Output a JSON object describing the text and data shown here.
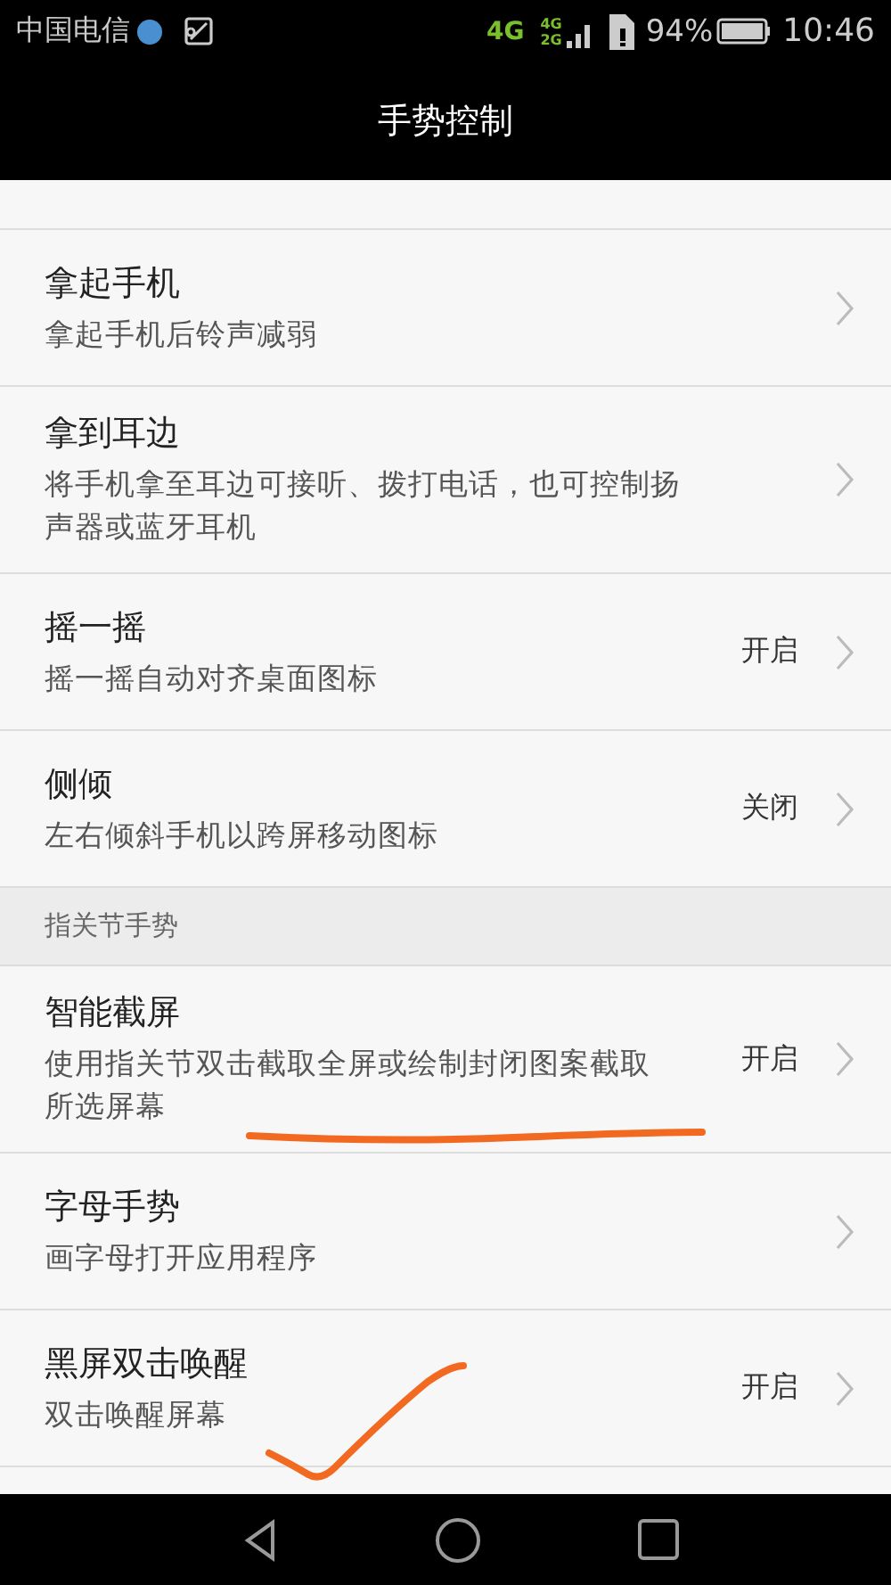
{
  "status_bar": {
    "carrier": "中国电信",
    "network": "4G",
    "network_2_top": "4G",
    "network_2_bottom": "2G",
    "battery": "94%",
    "time": "10:46"
  },
  "title_bar": {
    "title": "手势控制"
  },
  "list": [
    {
      "kind": "item",
      "title": "拿起手机",
      "subtitle": "拿起手机后铃声减弱"
    },
    {
      "kind": "item",
      "title": "拿到耳边",
      "subtitle": "将手机拿至耳边可接听、拨打电话，也可控制扬声器或蓝牙耳机"
    },
    {
      "kind": "item",
      "title": "摇一摇",
      "subtitle": "摇一摇自动对齐桌面图标",
      "value": "开启"
    },
    {
      "kind": "item",
      "title": "侧倾",
      "subtitle": "左右倾斜手机以跨屏移动图标",
      "value": "关闭"
    },
    {
      "kind": "header",
      "title": "指关节手势"
    },
    {
      "kind": "item",
      "title": "智能截屏",
      "subtitle": "使用指关节双击截取全屏或绘制封闭图案截取所选屏幕",
      "value": "开启"
    },
    {
      "kind": "item",
      "title": "字母手势",
      "subtitle": "画字母打开应用程序"
    },
    {
      "kind": "item",
      "title": "黑屏双击唤醒",
      "subtitle": "双击唤醒屏幕",
      "value": "开启"
    }
  ]
}
